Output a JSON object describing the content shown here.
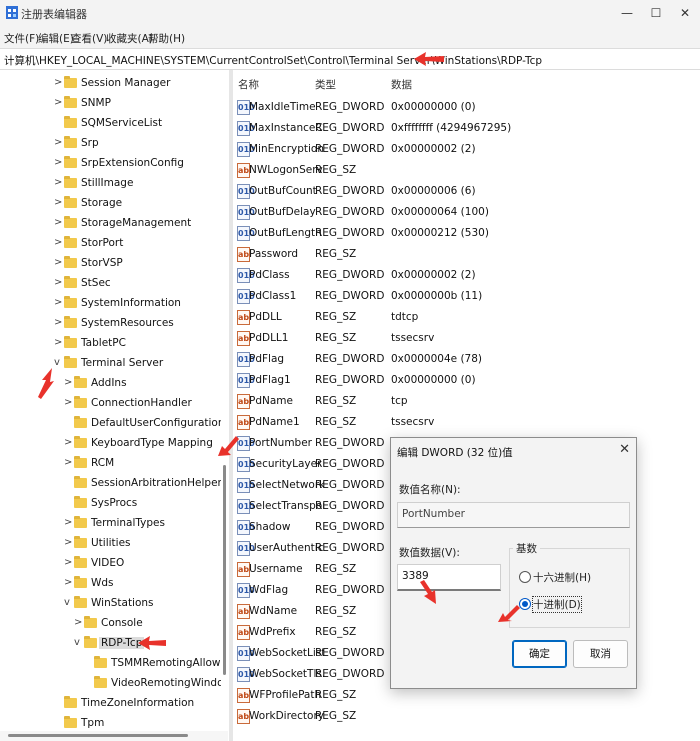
{
  "window": {
    "title": "注册表编辑器",
    "minimize_glyph": "—",
    "maximize_glyph": "☐",
    "close_glyph": "✕"
  },
  "menu": [
    "文件(F)",
    "编辑(E)",
    "查看(V)",
    "收藏夹(A)",
    "帮助(H)"
  ],
  "address": "计算机\\HKEY_LOCAL_MACHINE\\SYSTEM\\CurrentControlSet\\Control\\Terminal Server\\WinStations\\RDP-Tcp",
  "tree": {
    "items": [
      {
        "label": "Session Manager",
        "expand": ">"
      },
      {
        "label": "SNMP",
        "expand": ">"
      },
      {
        "label": "SQMServiceList",
        "expand": ""
      },
      {
        "label": "Srp",
        "expand": ">"
      },
      {
        "label": "SrpExtensionConfig",
        "expand": ">"
      },
      {
        "label": "StillImage",
        "expand": ">"
      },
      {
        "label": "Storage",
        "expand": ">"
      },
      {
        "label": "StorageManagement",
        "expand": ">"
      },
      {
        "label": "StorPort",
        "expand": ">"
      },
      {
        "label": "StorVSP",
        "expand": ">"
      },
      {
        "label": "StSec",
        "expand": ">"
      },
      {
        "label": "SystemInformation",
        "expand": ">"
      },
      {
        "label": "SystemResources",
        "expand": ">"
      },
      {
        "label": "TabletPC",
        "expand": ">"
      },
      {
        "label": "Terminal Server",
        "expand": "v"
      },
      {
        "label": "AddIns",
        "expand": ">"
      },
      {
        "label": "ConnectionHandler",
        "expand": ">"
      },
      {
        "label": "DefaultUserConfiguration",
        "expand": ""
      },
      {
        "label": "KeyboardType Mapping",
        "expand": ">"
      },
      {
        "label": "RCM",
        "expand": ">"
      },
      {
        "label": "SessionArbitrationHelper",
        "expand": ""
      },
      {
        "label": "SysProcs",
        "expand": ""
      },
      {
        "label": "TerminalTypes",
        "expand": ">"
      },
      {
        "label": "Utilities",
        "expand": ">"
      },
      {
        "label": "VIDEO",
        "expand": ">"
      },
      {
        "label": "Wds",
        "expand": ">"
      },
      {
        "label": "WinStations",
        "expand": "v"
      },
      {
        "label": "Console",
        "expand": ">"
      },
      {
        "label": "RDP-Tcp",
        "expand": "v"
      },
      {
        "label": "TSMMRemotingAllowedApps",
        "expand": ""
      },
      {
        "label": "VideoRemotingWindowNames",
        "expand": ""
      },
      {
        "label": "TimeZoneInformation",
        "expand": ""
      },
      {
        "label": "Tpm",
        "expand": ""
      }
    ]
  },
  "list": {
    "headers": {
      "name": "名称",
      "type": "类型",
      "data": "数据"
    },
    "rows": [
      {
        "name": "MaxIdleTime",
        "type": "REG_DWORD",
        "data": "0x00000000 (0)",
        "icon": "010"
      },
      {
        "name": "MaxInstanceC...",
        "type": "REG_DWORD",
        "data": "0xffffffff (4294967295)",
        "icon": "010"
      },
      {
        "name": "MinEncryption...",
        "type": "REG_DWORD",
        "data": "0x00000002 (2)",
        "icon": "010"
      },
      {
        "name": "NWLogonServer",
        "type": "REG_SZ",
        "data": "",
        "icon": "ab"
      },
      {
        "name": "OutBufCount",
        "type": "REG_DWORD",
        "data": "0x00000006 (6)",
        "icon": "010"
      },
      {
        "name": "OutBufDelay",
        "type": "REG_DWORD",
        "data": "0x00000064 (100)",
        "icon": "010"
      },
      {
        "name": "OutBufLength",
        "type": "REG_DWORD",
        "data": "0x00000212 (530)",
        "icon": "010"
      },
      {
        "name": "Password",
        "type": "REG_SZ",
        "data": "",
        "icon": "ab"
      },
      {
        "name": "PdClass",
        "type": "REG_DWORD",
        "data": "0x00000002 (2)",
        "icon": "010"
      },
      {
        "name": "PdClass1",
        "type": "REG_DWORD",
        "data": "0x0000000b (11)",
        "icon": "010"
      },
      {
        "name": "PdDLL",
        "type": "REG_SZ",
        "data": "tdtcp",
        "icon": "ab"
      },
      {
        "name": "PdDLL1",
        "type": "REG_SZ",
        "data": "tssecsrv",
        "icon": "ab"
      },
      {
        "name": "PdFlag",
        "type": "REG_DWORD",
        "data": "0x0000004e (78)",
        "icon": "010"
      },
      {
        "name": "PdFlag1",
        "type": "REG_DWORD",
        "data": "0x00000000 (0)",
        "icon": "010"
      },
      {
        "name": "PdName",
        "type": "REG_SZ",
        "data": "tcp",
        "icon": "ab"
      },
      {
        "name": "PdName1",
        "type": "REG_SZ",
        "data": "tssecsrv",
        "icon": "ab"
      },
      {
        "name": "PortNumber",
        "type": "REG_DWORD",
        "data": "",
        "icon": "010"
      },
      {
        "name": "SecurityLayer",
        "type": "REG_DWORD",
        "data": "",
        "icon": "010"
      },
      {
        "name": "SelectNetwork...",
        "type": "REG_DWORD",
        "data": "",
        "icon": "010"
      },
      {
        "name": "SelectTransport",
        "type": "REG_DWORD",
        "data": "",
        "icon": "010"
      },
      {
        "name": "Shadow",
        "type": "REG_DWORD",
        "data": "",
        "icon": "010"
      },
      {
        "name": "UserAuthentica...",
        "type": "REG_DWORD",
        "data": "",
        "icon": "010"
      },
      {
        "name": "Username",
        "type": "REG_SZ",
        "data": "",
        "icon": "ab"
      },
      {
        "name": "WdFlag",
        "type": "REG_DWORD",
        "data": "",
        "icon": "010"
      },
      {
        "name": "WdName",
        "type": "REG_SZ",
        "data": "",
        "icon": "ab"
      },
      {
        "name": "WdPrefix",
        "type": "REG_SZ",
        "data": "",
        "icon": "ab"
      },
      {
        "name": "WebSocketList...",
        "type": "REG_DWORD",
        "data": "",
        "icon": "010"
      },
      {
        "name": "WebSocketTls...",
        "type": "REG_DWORD",
        "data": "",
        "icon": "010"
      },
      {
        "name": "WFProfilePath",
        "type": "REG_SZ",
        "data": "",
        "icon": "ab"
      },
      {
        "name": "WorkDirectory",
        "type": "REG_SZ",
        "data": "",
        "icon": "ab"
      }
    ]
  },
  "dialog": {
    "title": "编辑 DWORD (32 位)值",
    "close_glyph": "✕",
    "name_label": "数值名称(N):",
    "name_value": "PortNumber",
    "data_label": "数值数据(V):",
    "data_value": "3389",
    "base_label": "基数",
    "hex_label": "十六进制(H)",
    "dec_label": "十进制(D)",
    "selected_base": "decimal",
    "ok_label": "确定",
    "cancel_label": "取消"
  },
  "colors": {
    "annotation_arrow": "#e8322b",
    "folder": "#f2c94c",
    "primary_border": "#0067c0"
  }
}
